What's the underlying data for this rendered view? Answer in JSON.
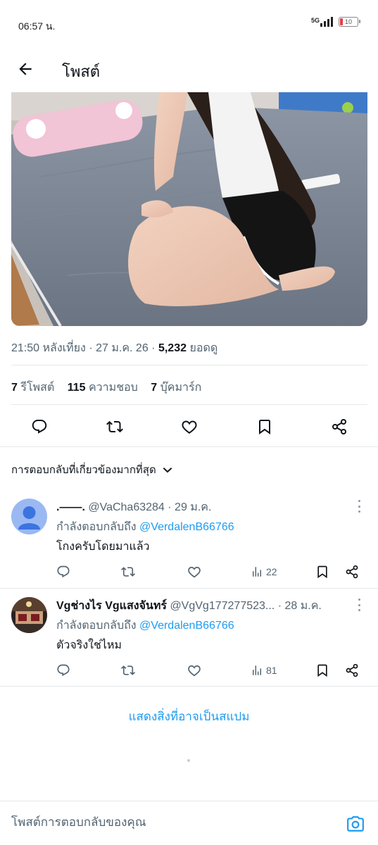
{
  "status_bar": {
    "time": "06:57 น.",
    "network": "5G",
    "battery_level": "10"
  },
  "header": {
    "title": "โพสต์"
  },
  "post": {
    "time": "21:50 หลังเที่ยง",
    "separator": "·",
    "date": "27 ม.ค. 26",
    "views_count": "5,232",
    "views_label": "ยอดดู",
    "reposts_count": "7",
    "reposts_label": "รีโพสต์",
    "likes_count": "115",
    "likes_label": "ความชอบ",
    "bookmarks_count": "7",
    "bookmarks_label": "บุ๊คมาร์ก"
  },
  "actions": [
    "reply-icon",
    "repost-icon",
    "like-icon",
    "bookmark-icon",
    "share-icon"
  ],
  "replies_sort": {
    "label": "การตอบกลับที่เกี่ยวข้องมากที่สุด"
  },
  "replies": [
    {
      "display_name": ".——.",
      "handle": "@VaCha63284",
      "time": "· 29 ม.ค.",
      "replying_to_label": "กำลังตอบกลับถึง",
      "replying_to_handle": "@VerdalenB66766",
      "text": "โกงครับโดยมาแล้ว",
      "views": "22"
    },
    {
      "display_name": "Vgช่างไร Vgแสงจันทร์",
      "handle": "@VgVg177277523...",
      "time": "· 28 ม.ค.",
      "replying_to_label": "กำลังตอบกลับถึง",
      "replying_to_handle": "@VerdalenB66766",
      "text": "ตัวจริงใช่ไหม",
      "views": "81"
    }
  ],
  "spam_link": "แสดงสิ่งที่อาจเป็นสแปม",
  "compose": {
    "placeholder": "โพสต์การตอบกลับของคุณ"
  },
  "colors": {
    "accent": "#1d9bf0",
    "text": "#0f1419",
    "muted": "#536471"
  }
}
